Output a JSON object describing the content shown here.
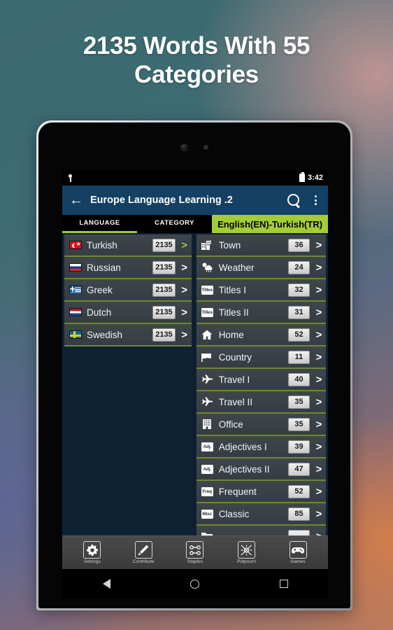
{
  "promo": {
    "headline": "2135 Words With 55 Categories",
    "background_colors": {
      "teal": "#3b6a70",
      "slate_blue": "#5c6a82",
      "mauve": "#8a6a72",
      "terracotta": "#b07a62"
    }
  },
  "statusbar": {
    "notification_icon": "pin-icon",
    "battery_icon": "battery-icon",
    "time": "3:42"
  },
  "appbar": {
    "back_icon": "back-arrow-icon",
    "title": "Europe Language Learning .2",
    "search_icon": "search-icon",
    "overflow_icon": "overflow-menu-icon",
    "background": "#134063"
  },
  "tabs": {
    "items": [
      {
        "label": "LANGUAGE",
        "active": true
      },
      {
        "label": "CATEGORY",
        "active": false
      }
    ],
    "pair_label": "English(EN)-Turkish(TR)",
    "pair_color": "#a4cc35",
    "accent": "#a4c639"
  },
  "languages": [
    {
      "name": "Turkish",
      "count": "2135",
      "flag": "flag-tr",
      "chevron": ">",
      "chevron_green": true
    },
    {
      "name": "Russian",
      "count": "2135",
      "flag": "flag-ru",
      "chevron": ">",
      "chevron_green": false
    },
    {
      "name": "Greek",
      "count": "2135",
      "flag": "flag-gr",
      "chevron": ">",
      "chevron_green": false
    },
    {
      "name": "Dutch",
      "count": "2135",
      "flag": "flag-nl",
      "chevron": ">",
      "chevron_green": false
    },
    {
      "name": "Swedish",
      "count": "2135",
      "flag": "flag-se",
      "chevron": ">",
      "chevron_green": false
    }
  ],
  "categories": [
    {
      "name": "Town",
      "count": "36",
      "icon": "town-icon",
      "icon_kind": "svg",
      "glyph": "town"
    },
    {
      "name": "Weather",
      "count": "24",
      "icon": "weather-icon",
      "icon_kind": "svg",
      "glyph": "weather"
    },
    {
      "name": "Titles I",
      "count": "32",
      "icon": "titles-icon",
      "icon_kind": "tag",
      "glyph": "Titles"
    },
    {
      "name": "Titles II",
      "count": "31",
      "icon": "titles-icon",
      "icon_kind": "tag",
      "glyph": "Titles"
    },
    {
      "name": "Home",
      "count": "52",
      "icon": "home-icon",
      "icon_kind": "svg",
      "glyph": "home"
    },
    {
      "name": "Country",
      "count": "11",
      "icon": "flag-icon",
      "icon_kind": "svg",
      "glyph": "flag"
    },
    {
      "name": "Travel I",
      "count": "40",
      "icon": "airplane-icon",
      "icon_kind": "svg",
      "glyph": "plane"
    },
    {
      "name": "Travel II",
      "count": "35",
      "icon": "airplane-icon",
      "icon_kind": "svg",
      "glyph": "plane"
    },
    {
      "name": "Office",
      "count": "35",
      "icon": "office-icon",
      "icon_kind": "svg",
      "glyph": "office"
    },
    {
      "name": "Adjectives I",
      "count": "39",
      "icon": "adjective-icon",
      "icon_kind": "tag",
      "glyph": "Adj."
    },
    {
      "name": "Adjectives II",
      "count": "47",
      "icon": "adjective-icon",
      "icon_kind": "tag",
      "glyph": "Adj."
    },
    {
      "name": "Frequent",
      "count": "52",
      "icon": "frequent-icon",
      "icon_kind": "tag",
      "glyph": "Freq"
    },
    {
      "name": "Classic",
      "count": "85",
      "icon": "misc-icon",
      "icon_kind": "tag",
      "glyph": "Misc"
    }
  ],
  "bottom_toolbar": [
    {
      "label": "Settings",
      "icon": "gear-icon"
    },
    {
      "label": "Contribute",
      "icon": "pencil-icon"
    },
    {
      "label": "Staples",
      "icon": "staples-icon"
    },
    {
      "label": "Potpourri",
      "icon": "potpourri-icon"
    },
    {
      "label": "Games",
      "icon": "gamepad-icon"
    }
  ],
  "navbar": [
    {
      "name": "back",
      "icon": "back-triangle-icon"
    },
    {
      "name": "home",
      "icon": "home-circle-icon"
    },
    {
      "name": "recents",
      "icon": "recents-square-icon"
    }
  ]
}
